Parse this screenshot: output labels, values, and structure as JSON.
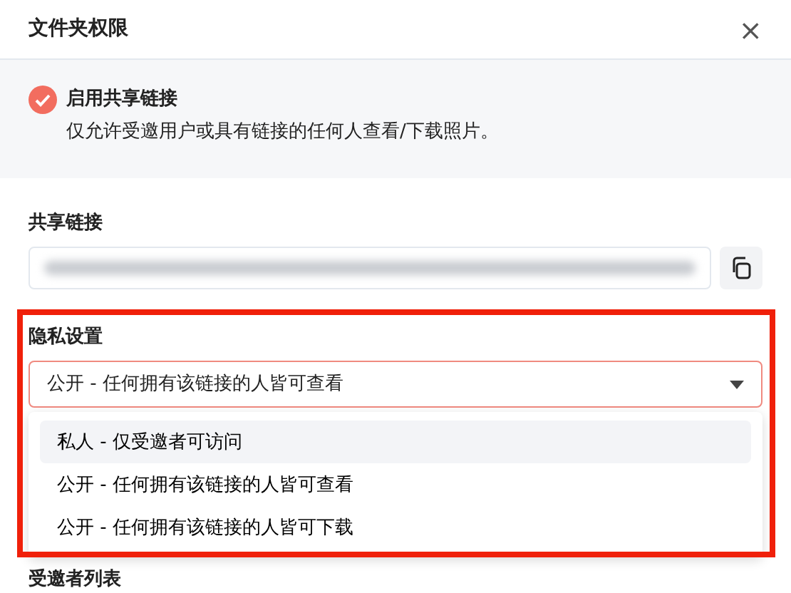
{
  "dialog": {
    "title": "文件夹权限",
    "close": "×"
  },
  "share": {
    "enabled": true,
    "title": "启用共享链接",
    "description": "仅允许受邀用户或具有链接的任何人查看/下载照片。"
  },
  "link": {
    "label": "共享链接",
    "blurred": true
  },
  "privacy": {
    "label": "隐私设置",
    "value": "公开 - 任何拥有该链接的人皆可查看",
    "open": true,
    "highlighted": true,
    "options": [
      {
        "label": "私人 - 仅受邀者可访问",
        "hovered": true
      },
      {
        "label": "公开 - 任何拥有该链接的人皆可查看",
        "hovered": false
      },
      {
        "label": "公开 - 任何拥有该链接的人皆可下载",
        "hovered": false
      }
    ]
  },
  "invitees": {
    "label": "受邀者列表"
  }
}
